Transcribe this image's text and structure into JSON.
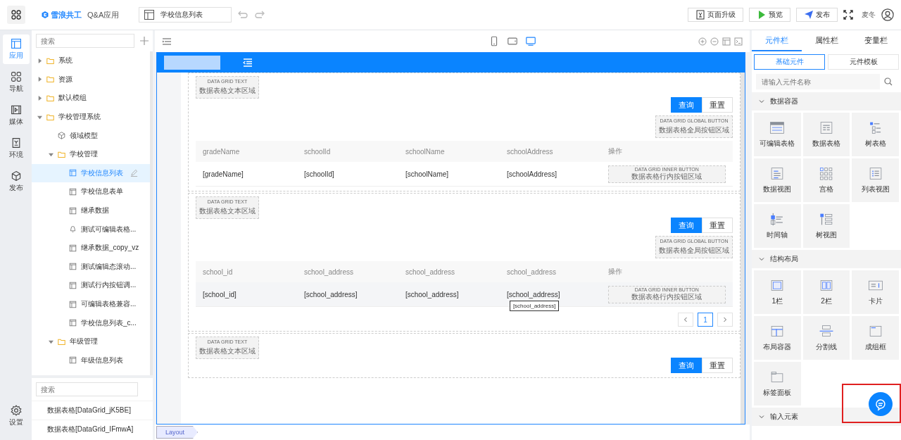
{
  "top_bar": {
    "brand": "雪浪共工",
    "app_name": "Q&A应用",
    "page_tab": "学校信息列表",
    "actions": [
      {
        "label": "页面升级",
        "kind": "upgrade"
      },
      {
        "label": "预览",
        "kind": "preview"
      },
      {
        "label": "发布",
        "kind": "publish"
      }
    ],
    "user": "麦冬"
  },
  "rail": [
    {
      "label": "应用",
      "kind": "app",
      "selected": true
    },
    {
      "label": "导航",
      "kind": "nav",
      "selected": false
    },
    {
      "label": "媒体",
      "kind": "media",
      "selected": false
    },
    {
      "label": "环境",
      "kind": "env",
      "selected": false
    },
    {
      "label": "发布",
      "kind": "publish",
      "selected": false
    }
  ],
  "rail_settings": "设置",
  "tree": {
    "placeholder": "搜索",
    "items": [
      {
        "label": "系统",
        "kind": "folder",
        "expanded": false,
        "selected": false
      },
      {
        "label": "资源",
        "kind": "folder",
        "expanded": false,
        "selected": false
      },
      {
        "label": "默认模组",
        "kind": "folder",
        "expanded": false,
        "selected": false
      },
      {
        "label": "学校管理系统",
        "kind": "folder",
        "expanded": true,
        "selected": false,
        "children": [
          {
            "label": "领域模型",
            "kind": "model",
            "selected": false
          },
          {
            "label": "学校管理",
            "kind": "folder",
            "expanded": true,
            "selected": false,
            "children": [
              {
                "label": "学校信息列表",
                "kind": "page",
                "selected": true
              },
              {
                "label": "学校信息表单",
                "kind": "page",
                "selected": false
              },
              {
                "label": "继承数据",
                "kind": "page",
                "selected": false
              },
              {
                "label": "测试可编辑表格...",
                "kind": "bell",
                "selected": false
              },
              {
                "label": "继承数据_copy_vz",
                "kind": "page",
                "selected": false
              },
              {
                "label": "测试编辑态滚动...",
                "kind": "page",
                "selected": false
              },
              {
                "label": "测试行内按钮调...",
                "kind": "page",
                "selected": false
              },
              {
                "label": "可编辑表格兼容...",
                "kind": "page",
                "selected": false
              },
              {
                "label": "学校信息列表_c...",
                "kind": "page",
                "selected": false
              }
            ]
          },
          {
            "label": "年级管理",
            "kind": "folder",
            "expanded": true,
            "selected": false,
            "children": [
              {
                "label": "年级信息列表",
                "kind": "page",
                "selected": false
              }
            ]
          }
        ]
      }
    ]
  },
  "outline": {
    "placeholder": "搜索",
    "items": [
      "数据表格[DataGrid_jK5BE]",
      "数据表格[DataGrid_IFmwA]"
    ]
  },
  "devices": [
    {
      "kind": "phone",
      "selected": false
    },
    {
      "kind": "tablet",
      "selected": false
    },
    {
      "kind": "desktop",
      "selected": true
    }
  ],
  "grids": [
    {
      "text_area": [
        "DATA GRID TEXT",
        "数据表格文本区域"
      ],
      "buttons": [
        {
          "label": "查询",
          "primary": true
        },
        {
          "label": "重置",
          "primary": false
        }
      ],
      "global_area": [
        "DATA GRID GLOBAL BUTTON",
        "数据表格全局按钮区域"
      ],
      "columns": [
        "gradeName",
        "schoolId",
        "schoolName",
        "schoolAddress",
        "操作"
      ],
      "rows": [
        [
          {
            "text": "[gradeName]"
          },
          {
            "text": "[schoolId]"
          },
          {
            "text": "[schoolName]"
          },
          {
            "text": "[schoolAddress]"
          }
        ]
      ],
      "inner_area": [
        "DATA GRID INNER BUTTON",
        "数据表格行内按钮区域"
      ]
    },
    {
      "text_area": [
        "DATA GRID TEXT",
        "数据表格文本区域"
      ],
      "buttons": [
        {
          "label": "查询",
          "primary": true
        },
        {
          "label": "重置",
          "primary": false
        }
      ],
      "global_area": [
        "DATA GRID GLOBAL BUTTON",
        "数据表格全局按钮区域"
      ],
      "columns": [
        "school_id",
        "school_address",
        "school_address",
        "school_address",
        "操作"
      ],
      "rows": [
        [
          {
            "text": "[school_id]"
          },
          {
            "text": "[school_address]"
          },
          {
            "text": "[school_address]"
          },
          {
            "text": "[school_address]",
            "tooltip": "[school_address]"
          }
        ]
      ],
      "inner_area": [
        "DATA GRID INNER BUTTON",
        "数据表格行内按钮区域"
      ],
      "pager": [
        {
          "label": "1",
          "selected": true
        }
      ]
    },
    {
      "text_area": [
        "DATA GRID TEXT",
        "数据表格文本区域"
      ],
      "buttons": [
        {
          "label": "查询",
          "primary": true
        },
        {
          "label": "重置",
          "primary": false
        }
      ]
    }
  ],
  "breadcrumb": "Layout",
  "panel": {
    "tabs": [
      {
        "label": "元件栏",
        "selected": true
      },
      {
        "label": "属性栏",
        "selected": false
      },
      {
        "label": "变量栏",
        "selected": false
      }
    ],
    "subtabs": [
      {
        "label": "基础元件",
        "selected": true
      },
      {
        "label": "元件模板",
        "selected": false
      }
    ],
    "placeholder": "请输入元件名称",
    "groups": [
      {
        "title": "数据容器",
        "expanded": true,
        "items": [
          {
            "label": "可编辑表格",
            "kind": "edit-table"
          },
          {
            "label": "数据表格",
            "kind": "data-table"
          },
          {
            "label": "树表格",
            "kind": "tree-table"
          },
          {
            "label": "数据视图",
            "kind": "data-view"
          },
          {
            "label": "宫格",
            "kind": "grid"
          },
          {
            "label": "列表视图",
            "kind": "list-view"
          },
          {
            "label": "时间轴",
            "kind": "timeline"
          },
          {
            "label": "树视图",
            "kind": "tree-view"
          }
        ]
      },
      {
        "title": "结构布局",
        "expanded": true,
        "items": [
          {
            "label": "1栏",
            "kind": "col1"
          },
          {
            "label": "2栏",
            "kind": "col2"
          },
          {
            "label": "卡片",
            "kind": "card"
          },
          {
            "label": "布局容器",
            "kind": "layout"
          },
          {
            "label": "分割线",
            "kind": "divider"
          },
          {
            "label": "成组框",
            "kind": "groupbox"
          },
          {
            "label": "标签面板",
            "kind": "tabs"
          }
        ]
      },
      {
        "title": "输入元素",
        "expanded": false
      }
    ]
  }
}
